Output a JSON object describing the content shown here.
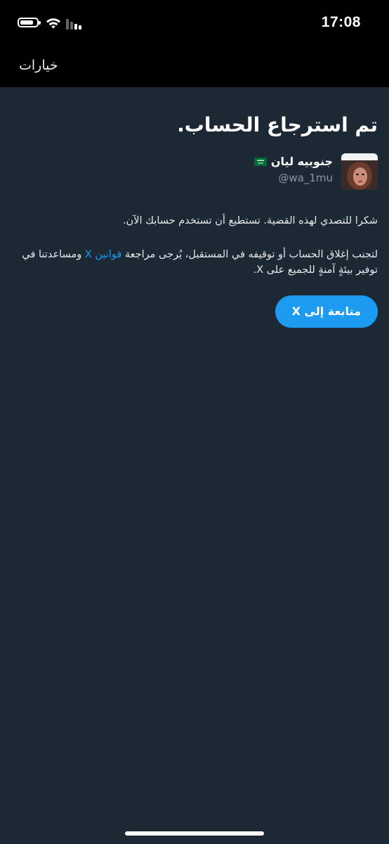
{
  "status_bar": {
    "time": "17:08"
  },
  "nav": {
    "options_label": "خيارات"
  },
  "main": {
    "title": "تم استرجاع الحساب.",
    "account": {
      "name": "جنوبيه ليان",
      "handle": "@wa_1mu"
    },
    "message1": "شكرا للتصدي لهذه القضية. تستطيع أن تستخدم حسابك الآن.",
    "message2_before": "لتجنب إغلاق الحساب أو توقيفه في المستقبل، يُرجى مراجعة ",
    "message2_link": "قوانين X",
    "message2_after": " ومساعدتنا في توفير بيئةٍ آمنةٍ للجميع على X.",
    "continue_label": "متابعة إلى X"
  },
  "colors": {
    "background": "#1c2834",
    "accent": "#1d9bf0",
    "muted": "#8b98a5"
  },
  "icons": [
    "battery-icon",
    "wifi-icon",
    "signal-icon",
    "saudi-flag-icon"
  ]
}
